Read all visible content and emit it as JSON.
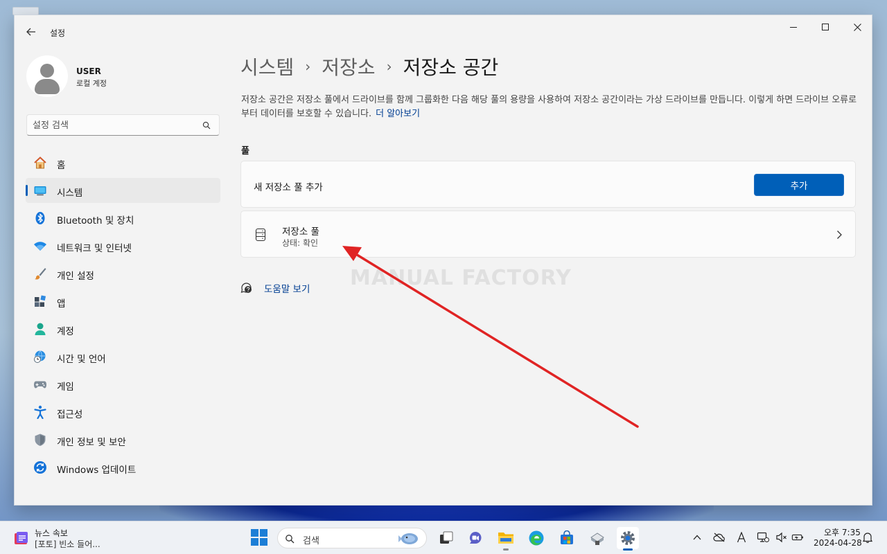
{
  "window": {
    "app_title": "설정",
    "back_icon": "back-arrow-icon",
    "controls": [
      "minimize",
      "maximize",
      "close"
    ]
  },
  "profile": {
    "name": "USER",
    "account_type": "로컬 계정"
  },
  "sidebar_search": {
    "placeholder": "설정 검색"
  },
  "nav": [
    {
      "label": "홈",
      "icon": "home-icon"
    },
    {
      "label": "시스템",
      "icon": "system-icon",
      "active": true
    },
    {
      "label": "Bluetooth 및 장치",
      "icon": "bluetooth-icon"
    },
    {
      "label": "네트워크 및 인터넷",
      "icon": "wifi-icon"
    },
    {
      "label": "개인 설정",
      "icon": "brush-icon"
    },
    {
      "label": "앱",
      "icon": "apps-icon"
    },
    {
      "label": "계정",
      "icon": "account-icon"
    },
    {
      "label": "시간 및 언어",
      "icon": "globe-clock-icon"
    },
    {
      "label": "게임",
      "icon": "gamepad-icon"
    },
    {
      "label": "접근성",
      "icon": "accessibility-icon"
    },
    {
      "label": "개인 정보 및 보안",
      "icon": "shield-icon"
    },
    {
      "label": "Windows 업데이트",
      "icon": "update-icon"
    }
  ],
  "breadcrumb": {
    "level1": "시스템",
    "level2": "저장소",
    "current": "저장소 공간",
    "separator": "›"
  },
  "description": {
    "text": "저장소 공간은 저장소 풀에서 드라이브를 함께 그룹화한 다음 해당 풀의 용량을 사용하여 저장소 공간이라는 가상 드라이브를 만듭니다. 이렇게 하면 드라이브 오류로부터 데이터를 보호할 수 있습니다.",
    "link": "더 알아보기"
  },
  "pools_section": {
    "label": "풀",
    "add_card": {
      "label": "새 저장소 풀 추가",
      "button": "추가"
    },
    "pool_card": {
      "title": "저장소 풀",
      "status": "상태: 확인"
    }
  },
  "help": {
    "link": "도움말 보기"
  },
  "watermark": "MANUAL FACTORY",
  "taskbar": {
    "news_title": "뉴스 속보",
    "news_text": "[포토] 빈소 들어...",
    "search_label": "검색",
    "apps": [
      "task-view-icon",
      "chat-icon",
      "file-explorer-icon",
      "edge-icon",
      "store-icon",
      "app-icon",
      "settings-icon"
    ],
    "clock_time": "오후 7:35",
    "clock_date": "2024-04-28"
  },
  "colors": {
    "accent": "#005fb8",
    "link": "#003e92",
    "annotation_arrow": "#e02424"
  }
}
